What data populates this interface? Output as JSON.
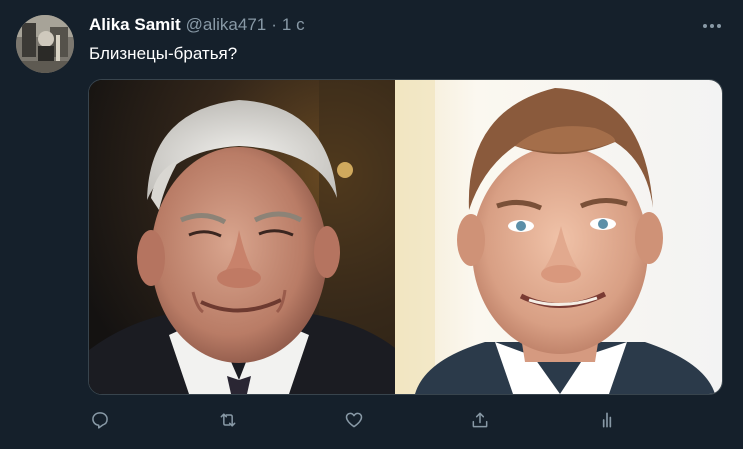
{
  "tweet": {
    "author": {
      "display_name": "Alika Samit",
      "handle": "@alika471",
      "avatar_icon": "avatar"
    },
    "separator": "·",
    "time": "1 с",
    "text": "Близнецы-братья?",
    "media": {
      "left_photo_icon": "photo-older-man-portrait",
      "right_photo_icon": "photo-younger-man-portrait"
    },
    "more_icon": "more-horizontal-icon"
  },
  "actions": [
    {
      "name": "reply",
      "icon": "reply-icon"
    },
    {
      "name": "retweet",
      "icon": "retweet-icon"
    },
    {
      "name": "like",
      "icon": "heart-icon"
    },
    {
      "name": "share",
      "icon": "share-icon"
    },
    {
      "name": "analytics",
      "icon": "analytics-icon"
    }
  ],
  "colors": {
    "background": "#15202b",
    "text_primary": "#ffffff",
    "text_secondary": "#8899a6",
    "border": "#38444d"
  }
}
